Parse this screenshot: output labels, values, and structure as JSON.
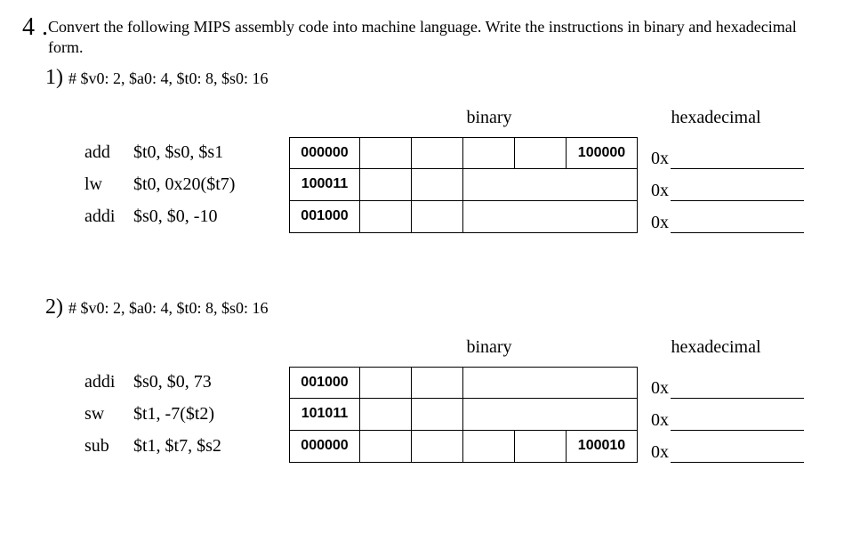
{
  "question": {
    "number": "4",
    "dot": ".",
    "text": "Convert the following MIPS assembly code into machine language. Write the instructions in binary and hexadecimal form."
  },
  "sub1": {
    "number": "1)",
    "text": "# $v0: 2, $a0: 4, $t0: 8, $s0: 16",
    "headers": {
      "binary": "binary",
      "hex": "hexadecimal"
    },
    "rows": [
      {
        "mnemonic": "add",
        "operands": "$t0, $s0, $s1",
        "opcode": "000000",
        "funct": "100000",
        "hex_prefix": "0x",
        "type": "R"
      },
      {
        "mnemonic": "lw",
        "operands": "$t0, 0x20($t7)",
        "opcode": "100011",
        "funct": "",
        "hex_prefix": "0x",
        "type": "I"
      },
      {
        "mnemonic": "addi",
        "operands": "$s0, $0, -10",
        "opcode": "001000",
        "funct": "",
        "hex_prefix": "0x",
        "type": "I"
      }
    ]
  },
  "sub2": {
    "number": "2)",
    "text": "# $v0: 2, $a0: 4, $t0: 8, $s0: 16",
    "headers": {
      "binary": "binary",
      "hex": "hexadecimal"
    },
    "rows": [
      {
        "mnemonic": "addi",
        "operands": "$s0, $0, 73",
        "opcode": "001000",
        "funct": "",
        "hex_prefix": "0x",
        "type": "I"
      },
      {
        "mnemonic": "sw",
        "operands": "$t1, -7($t2)",
        "opcode": "101011",
        "funct": "",
        "hex_prefix": "0x",
        "type": "I"
      },
      {
        "mnemonic": "sub",
        "operands": "$t1, $t7, $s2",
        "opcode": "000000",
        "funct": "100010",
        "hex_prefix": "0x",
        "type": "R"
      }
    ]
  }
}
